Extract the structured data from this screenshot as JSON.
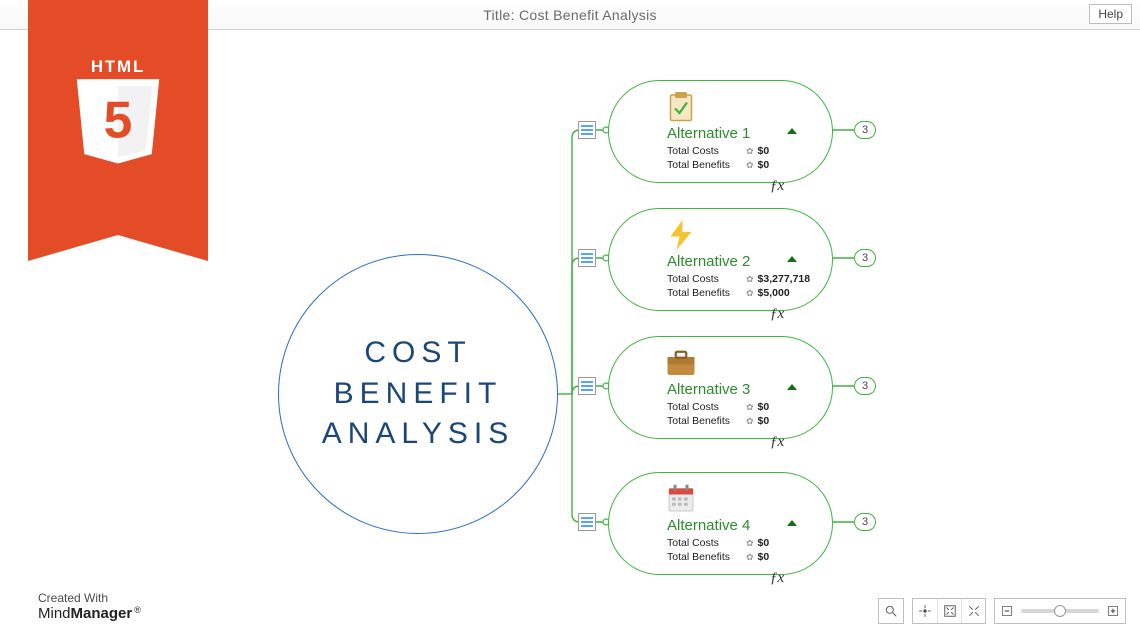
{
  "header": {
    "title": "Title: Cost Benefit Analysis",
    "help_label": "Help"
  },
  "ribbon": {
    "text": "HTML",
    "glyph": "5"
  },
  "credits": {
    "created_with": "Created With",
    "brand_prefix": "Mind",
    "brand_bold": "Manager",
    "reg": "®"
  },
  "central": {
    "line1": "COST",
    "line2": "BENEFIT",
    "line3": "ANALYSIS"
  },
  "labels": {
    "total_costs": "Total Costs",
    "total_benefits": "Total Benefits"
  },
  "fx": "ƒx",
  "alts": [
    {
      "title": "Alternative 1",
      "costs": "$0",
      "benefits": "$0",
      "badge": "3",
      "icon": "clipboard"
    },
    {
      "title": "Alternative 2",
      "costs": "$3,277,718",
      "benefits": "$5,000",
      "badge": "3",
      "icon": "bolt"
    },
    {
      "title": "Alternative 3",
      "costs": "$0",
      "benefits": "$0",
      "badge": "3",
      "icon": "briefcase"
    },
    {
      "title": "Alternative 4",
      "costs": "$0",
      "benefits": "$0",
      "badge": "3",
      "icon": "calendar"
    }
  ]
}
